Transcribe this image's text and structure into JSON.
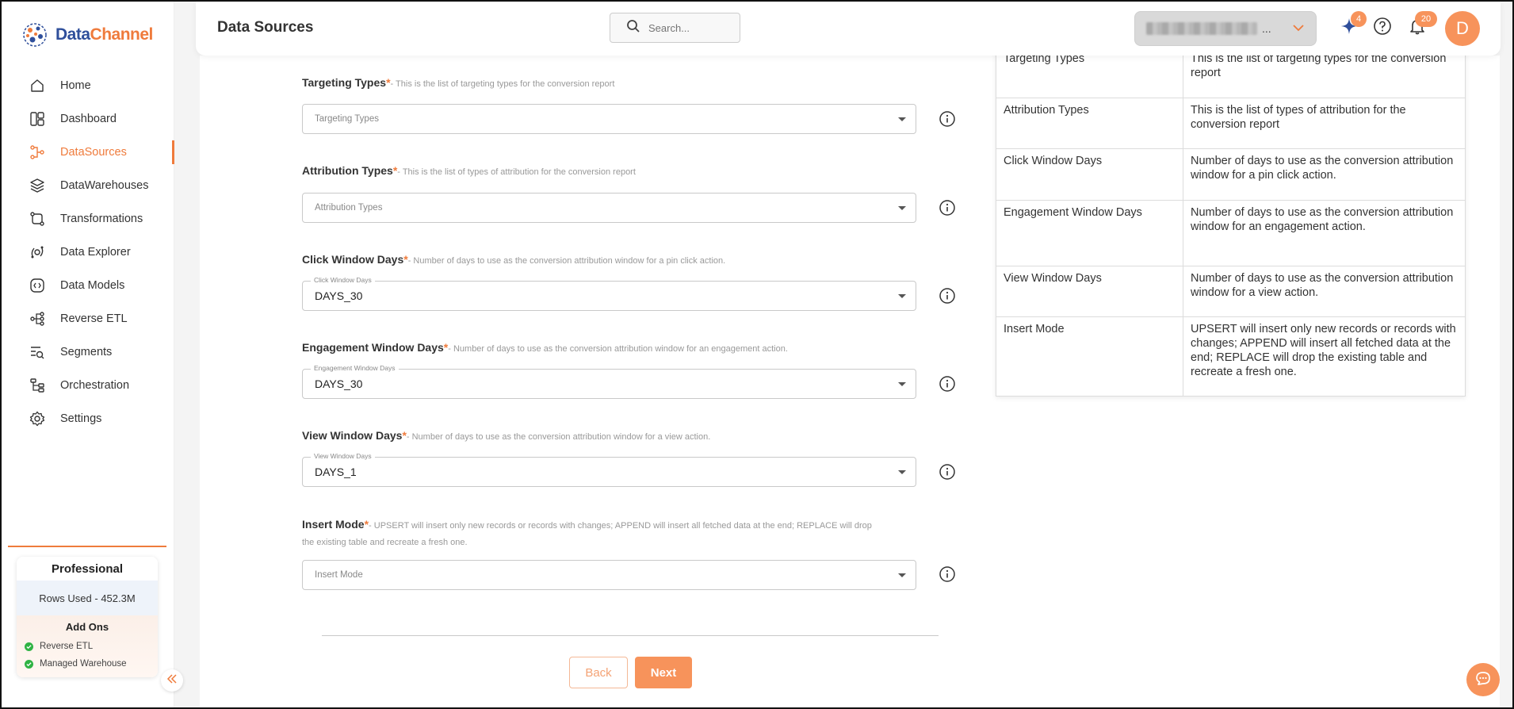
{
  "app": {
    "logo_part1": "Data",
    "logo_part2": "Channel"
  },
  "sidebar": {
    "items": [
      {
        "label": "Home",
        "icon": "home-icon"
      },
      {
        "label": "Dashboard",
        "icon": "dashboard-icon"
      },
      {
        "label": "DataSources",
        "icon": "datasources-icon",
        "active": true
      },
      {
        "label": "DataWarehouses",
        "icon": "layers-icon"
      },
      {
        "label": "Transformations",
        "icon": "transform-icon"
      },
      {
        "label": "Data Explorer",
        "icon": "explorer-icon"
      },
      {
        "label": "Data Models",
        "icon": "models-icon"
      },
      {
        "label": "Reverse ETL",
        "icon": "reverse-etl-icon"
      },
      {
        "label": "Segments",
        "icon": "segments-icon"
      },
      {
        "label": "Orchestration",
        "icon": "orchestration-icon"
      },
      {
        "label": "Settings",
        "icon": "gear-icon"
      }
    ],
    "plan": {
      "name": "Professional",
      "rows_used": "Rows Used - 452.3M",
      "addons_title": "Add Ons",
      "addons": [
        "Reverse ETL",
        "Managed Warehouse"
      ]
    }
  },
  "header": {
    "title": "Data Sources",
    "search_placeholder": "Search...",
    "workspace_suffix": "...",
    "sparkle_badge": "4",
    "notification_badge": "20",
    "avatar_initial": "D"
  },
  "form": {
    "fields": [
      {
        "label": "Targeting Types",
        "required": "*",
        "description": "- This is the list of targeting types for the conversion report",
        "placeholder": "Targeting Types",
        "value": ""
      },
      {
        "label": "Attribution Types",
        "required": "*",
        "description": "- This is the list of types of attribution for the conversion report",
        "placeholder": "Attribution Types",
        "value": ""
      },
      {
        "label": "Click Window Days",
        "required": "*",
        "description": "- Number of days to use as the conversion attribution window for a pin click action.",
        "float_label": "Click Window Days",
        "value": "DAYS_30"
      },
      {
        "label": "Engagement Window Days",
        "required": "*",
        "description": "- Number of days to use as the conversion attribution window for an engagement action.",
        "float_label": "Engagement Window Days",
        "value": "DAYS_30"
      },
      {
        "label": "View Window Days",
        "required": "*",
        "description": "- Number of days to use as the conversion attribution window for a view action.",
        "float_label": "View Window Days",
        "value": "DAYS_1"
      },
      {
        "label": "Insert Mode",
        "required": "*",
        "description": "- UPSERT will insert only new records or records with changes; APPEND will insert all fetched data at the end; REPLACE will drop the existing table and recreate a fresh one.",
        "placeholder": "Insert Mode",
        "value": ""
      }
    ],
    "back_label": "Back",
    "next_label": "Next"
  },
  "docs": {
    "rows": [
      {
        "key": "Targeting Types",
        "value": "This is the list of targeting types for the conversion report"
      },
      {
        "key": "Attribution Types",
        "value": "This is the list of types of attribution for the conversion report"
      },
      {
        "key": "Click Window Days",
        "value": "Number of days to use as the conversion attribution window for a pin click action."
      },
      {
        "key": "Engagement Window Days",
        "value": "Number of days to use as the conversion attribution window for an engagement action."
      },
      {
        "key": "View Window Days",
        "value": "Number of days to use as the conversion attribution window for a view action."
      },
      {
        "key": "Insert Mode",
        "value": "UPSERT will insert only new records or records with changes; APPEND will insert all fetched data at the end; REPLACE will drop the existing table and recreate a fresh one."
      }
    ]
  },
  "colors": {
    "accent": "#ef7b3c",
    "button": "#f7935b",
    "brand_blue": "#2f4f9b"
  }
}
